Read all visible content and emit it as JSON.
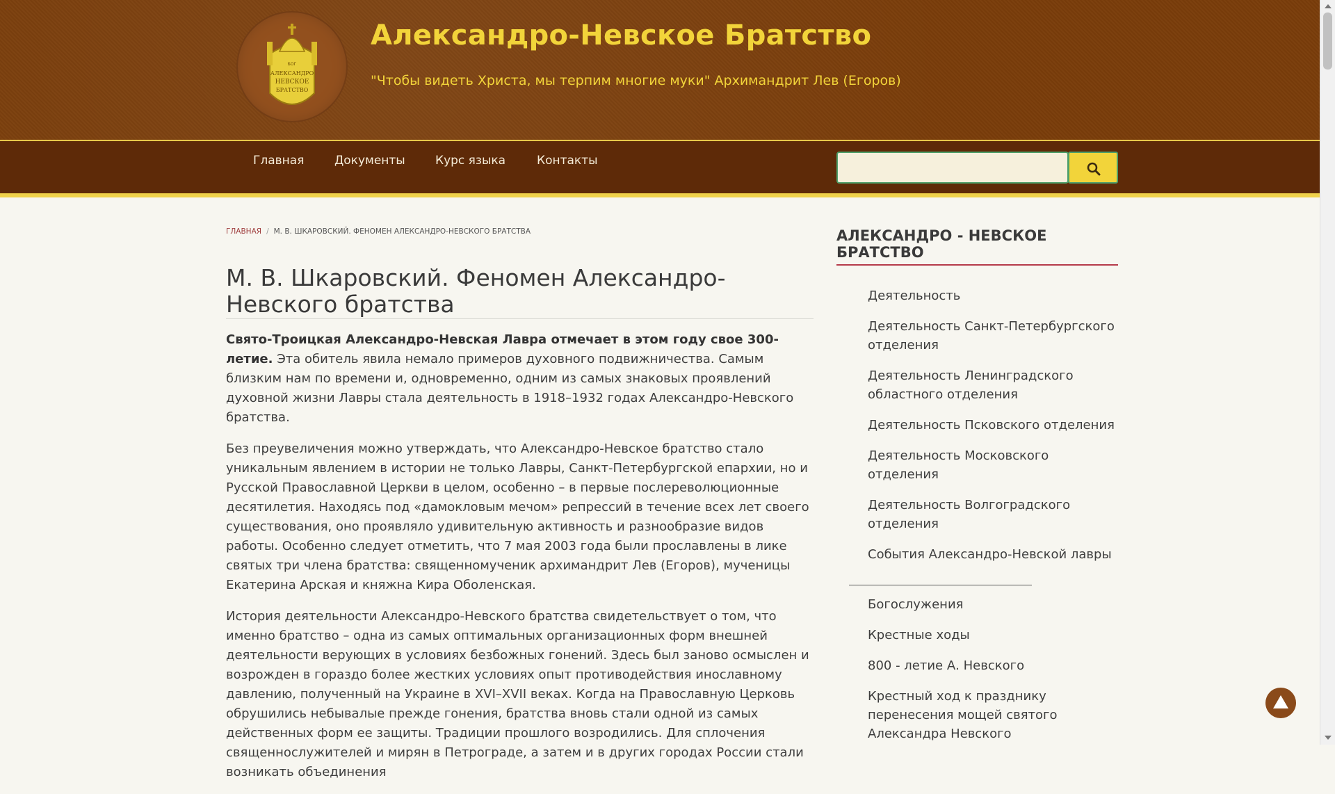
{
  "header": {
    "title": "Александро-Невское Братство",
    "tagline": "\"Чтобы видеть Христа, мы терпим многие муки\" Архимандрит Лев (Егоров)",
    "logo_icon": "brotherhood-emblem-icon",
    "logo_text": [
      "БОГ",
      "АЛЕКСАНДРО",
      "НЕВСКОЕ",
      "БРАТСТВО"
    ]
  },
  "nav": {
    "items": [
      "Главная",
      "Документы",
      "Курс языка",
      "Контакты"
    ]
  },
  "search": {
    "placeholder": "",
    "button_icon": "search-icon"
  },
  "breadcrumb": {
    "home": "Главная",
    "separator": "/",
    "current": "М. В. Шкаровский. Феномен Александро-Невского братства"
  },
  "article": {
    "title": "М. В. Шкаровский. Феномен Александро-Невского братства",
    "p1_bold": "Свято-Троицкая Александро-Невская Лавра отмечает в этом году свое 300-летие.",
    "p1_rest": " Эта обитель явила немало примеров духовного подвижничества. Самым близким нам по времени и, одновременно, одним из самых знаковых проявлений духовной жизни Лавры стала деятельность в 1918–1932 годах Александро-Невского братства.",
    "p2": "Без преувеличения можно утверждать, что Александро-Невское братство стало уникальным явлением в истории не только Лавры, Санкт-Петербургской епархии, но и Русской Православной Церкви в целом, особенно – в первые послереволюционные десятилетия. Находясь под «дамокловым мечом» репрессий в течение всех лет своего существования, оно проявляло удивительную активность и разнообразие видов работы. Особенно следует отметить, что 7 мая 2003 года были прославлены в лике святых три члена братства: священномученик архимандрит Лев (Егоров), мученицы Екатерина Арская и княжна Кира Оболенская.",
    "p3": "История деятельности Александро-Невского братства свидетельствует о том, что именно братство – одна из самых оптимальных организационных форм внешней деятельности верующих в условиях безбожных гонений. Здесь был заново осмыслен и возрожден в гораздо более жестких условиях опыт противодействия инославному давлению, полученный на Украине в XVI–XVII веках. Когда на Православную Церковь обрушились небывалые прежде гонения, братства вновь стали одной из самых действенных форм ее защиты. Традиции прошлого возродились. Для сплочения священнослужителей и мирян в Петрограде, а затем и в других городах России стали возникать объединения"
  },
  "sidebar": {
    "title": "АЛЕКСАНДРО - НЕВСКОЕ БРАТСТВО",
    "items": [
      "Деятельность",
      "Деятельность Санкт-Петербургского отделения",
      "Деятельность Ленинградского областного отделения",
      "Деятельность Псковского отделения",
      "Деятельность Московского отделения",
      "Деятельность Волгоградского отделения",
      "События Александро-Невской лавры"
    ],
    "items2": [
      "Богослужения",
      "Крестные ходы",
      "800 - летие А. Невского",
      "Крестный ход к празднику перенесения мощей святого Александра Невского"
    ]
  },
  "scroll_top_icon": "arrow-up-icon",
  "colors": {
    "header_bg": "#7a3d0a",
    "nav_bg": "#5e2a08",
    "accent_yellow": "#f2d43a",
    "sidebar_rule": "#b53a4a",
    "page_bg": "#f7f6f0"
  }
}
